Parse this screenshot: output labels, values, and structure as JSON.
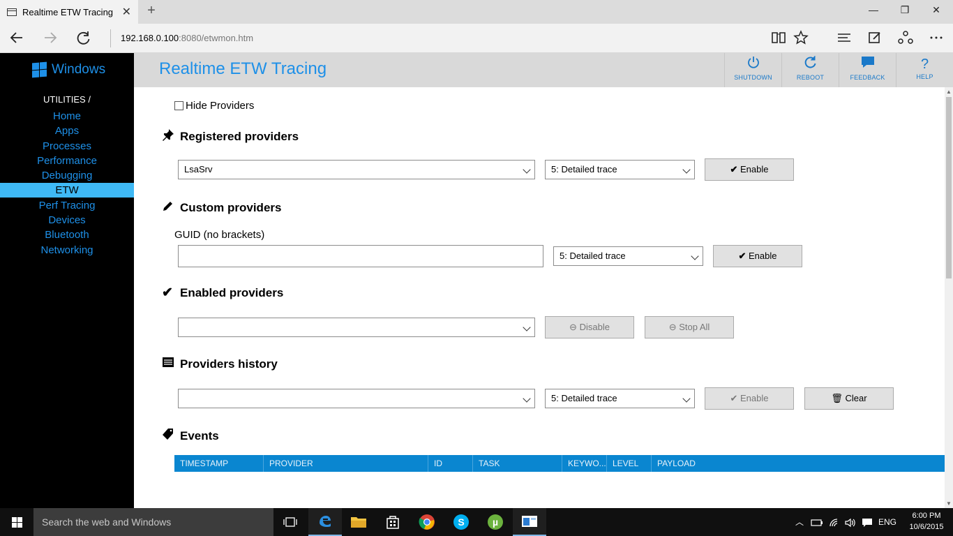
{
  "browser": {
    "tab_title": "Realtime ETW Tracing",
    "tab_close": "✕",
    "new_tab": "+",
    "window_minimize": "—",
    "window_restore": "❐",
    "window_close": "✕",
    "address_host": "192.168.0.100",
    "address_rest": ":8080/etwmon.htm",
    "icons": [
      "back-icon",
      "forward-icon",
      "refresh-icon",
      "reading-view-icon",
      "favorite-star-icon",
      "hub-icon",
      "web-note-icon",
      "share-icon",
      "more-icon"
    ]
  },
  "sidebar": {
    "logo": "Windows",
    "section": "UTILITIES /",
    "items": [
      {
        "label": "Home"
      },
      {
        "label": "Apps"
      },
      {
        "label": "Processes"
      },
      {
        "label": "Performance"
      },
      {
        "label": "Debugging"
      },
      {
        "label": "ETW"
      },
      {
        "label": "Perf Tracing"
      },
      {
        "label": "Devices"
      },
      {
        "label": "Bluetooth"
      },
      {
        "label": "Networking"
      }
    ],
    "active_item": "ETW"
  },
  "header": {
    "title": "Realtime ETW Tracing",
    "buttons": [
      {
        "label": "SHUTDOWN",
        "icon": "power-icon"
      },
      {
        "label": "REBOOT",
        "icon": "reboot-icon"
      },
      {
        "label": "FEEDBACK",
        "icon": "feedback-icon"
      },
      {
        "label": "HELP",
        "icon": "help-icon"
      }
    ]
  },
  "content": {
    "hide_providers_label": "Hide Providers",
    "registered": {
      "title": "Registered providers",
      "provider_value": "LsaSrv",
      "level_value": "5: Detailed trace",
      "enable_label": "Enable"
    },
    "custom": {
      "title": "Custom providers",
      "guid_label": "GUID (no brackets)",
      "guid_value": "",
      "level_value": "5: Detailed trace",
      "enable_label": "Enable"
    },
    "enabled": {
      "title": "Enabled providers",
      "provider_value": "",
      "disable_label": "Disable",
      "stop_all_label": "Stop All"
    },
    "history": {
      "title": "Providers history",
      "provider_value": "",
      "level_value": "5: Detailed trace",
      "enable_label": "Enable",
      "clear_label": "Clear"
    },
    "events": {
      "title": "Events",
      "columns": [
        "TIMESTAMP",
        "PROVIDER",
        "ID",
        "TASK",
        "KEYWO...",
        "LEVEL",
        "PAYLOAD"
      ]
    }
  },
  "taskbar": {
    "search_placeholder": "Search the web and Windows",
    "language": "ENG",
    "time": "6:00 PM",
    "date": "10/6/2015",
    "accent_color": "#0a86d0"
  }
}
